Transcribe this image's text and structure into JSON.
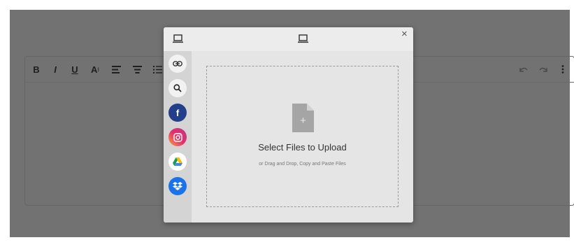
{
  "editor": {
    "toolbar": {
      "bold_label": "B",
      "italic_label": "I",
      "underline_label": "U",
      "font_size_label": "A",
      "icons": [
        "align-left-icon",
        "align-center-icon",
        "list-icon",
        "undo-icon",
        "redo-icon",
        "more-vertical-icon"
      ]
    }
  },
  "modal": {
    "close_label": "×",
    "header_icons": [
      "laptop-icon",
      "laptop-icon"
    ],
    "sources": [
      {
        "name": "link",
        "icon": "link-icon",
        "bg": "#f2f2f2"
      },
      {
        "name": "search",
        "icon": "search-icon",
        "bg": "#f2f2f2"
      },
      {
        "name": "facebook",
        "icon": "facebook-icon",
        "bg": "#233e8b"
      },
      {
        "name": "instagram",
        "icon": "instagram-icon",
        "bg": "#e1306c"
      },
      {
        "name": "google-drive",
        "icon": "google-drive-icon",
        "bg": "#ffffff"
      },
      {
        "name": "dropbox",
        "icon": "dropbox-icon",
        "bg": "#1a73e8"
      }
    ],
    "dropzone": {
      "title": "Select Files to Upload",
      "subtitle": "or Drag and Drop, Copy and Paste Files"
    }
  },
  "colors": {
    "backdrop": "#727272",
    "modal_bg": "#e5e5e5",
    "sidebar_bg": "#d4d4d4",
    "facebook": "#233e8b",
    "dropbox": "#1a73e8"
  }
}
